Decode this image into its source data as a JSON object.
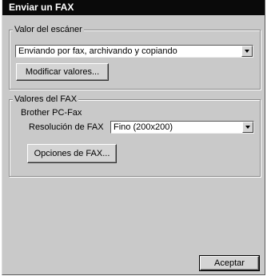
{
  "window": {
    "title": "Enviar un FAX"
  },
  "scanner_group": {
    "legend": "Valor del escáner",
    "mode_select_value": "Enviando por fax, archivando y copiando",
    "modify_button": "Modificar valores..."
  },
  "fax_group": {
    "legend": "Valores del FAX",
    "device_name": "Brother PC-Fax",
    "resolution_label": "Resolución de FAX",
    "resolution_value": "Fino (200x200)",
    "options_button": "Opciones de FAX..."
  },
  "footer": {
    "accept_button": "Aceptar"
  },
  "icons": {
    "dropdown": "chevron-down-icon"
  }
}
